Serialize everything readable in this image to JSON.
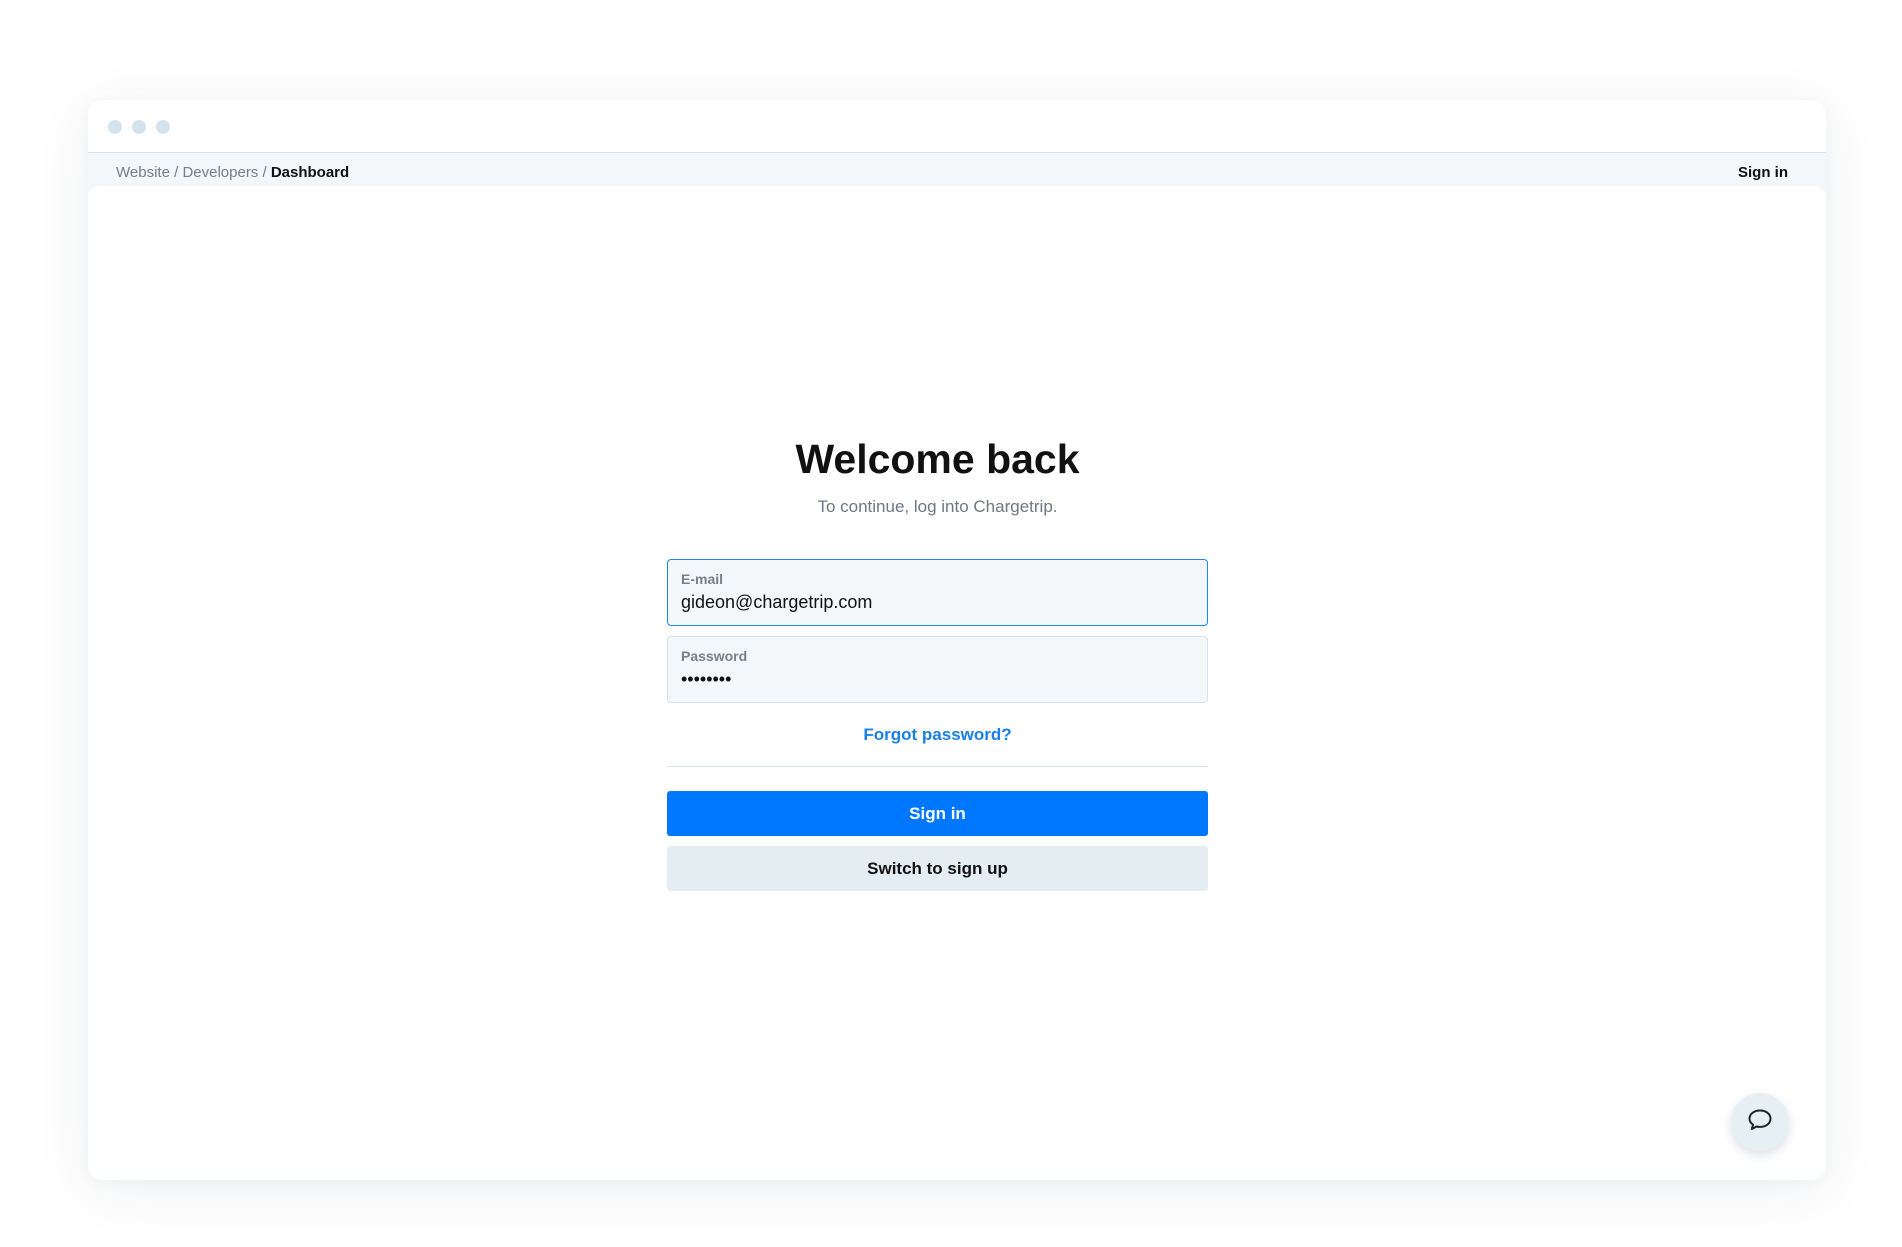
{
  "breadcrumb": {
    "items": [
      "Website",
      "Developers"
    ],
    "separator": " / ",
    "current": "Dashboard"
  },
  "nav": {
    "signin_label": "Sign in"
  },
  "login": {
    "title": "Welcome back",
    "subtitle": "To continue, log into Chargetrip.",
    "email_label": "E-mail",
    "email_value": "gideon@chargetrip.com",
    "password_label": "Password",
    "password_value": "••••••••",
    "forgot_label": "Forgot password?",
    "signin_button": "Sign in",
    "signup_button": "Switch to sign up"
  },
  "colors": {
    "accent": "#0077ff",
    "link": "#1a7fe6",
    "focus_border": "#1f86f0"
  },
  "icons": {
    "chat": "chat-bubble-icon"
  }
}
